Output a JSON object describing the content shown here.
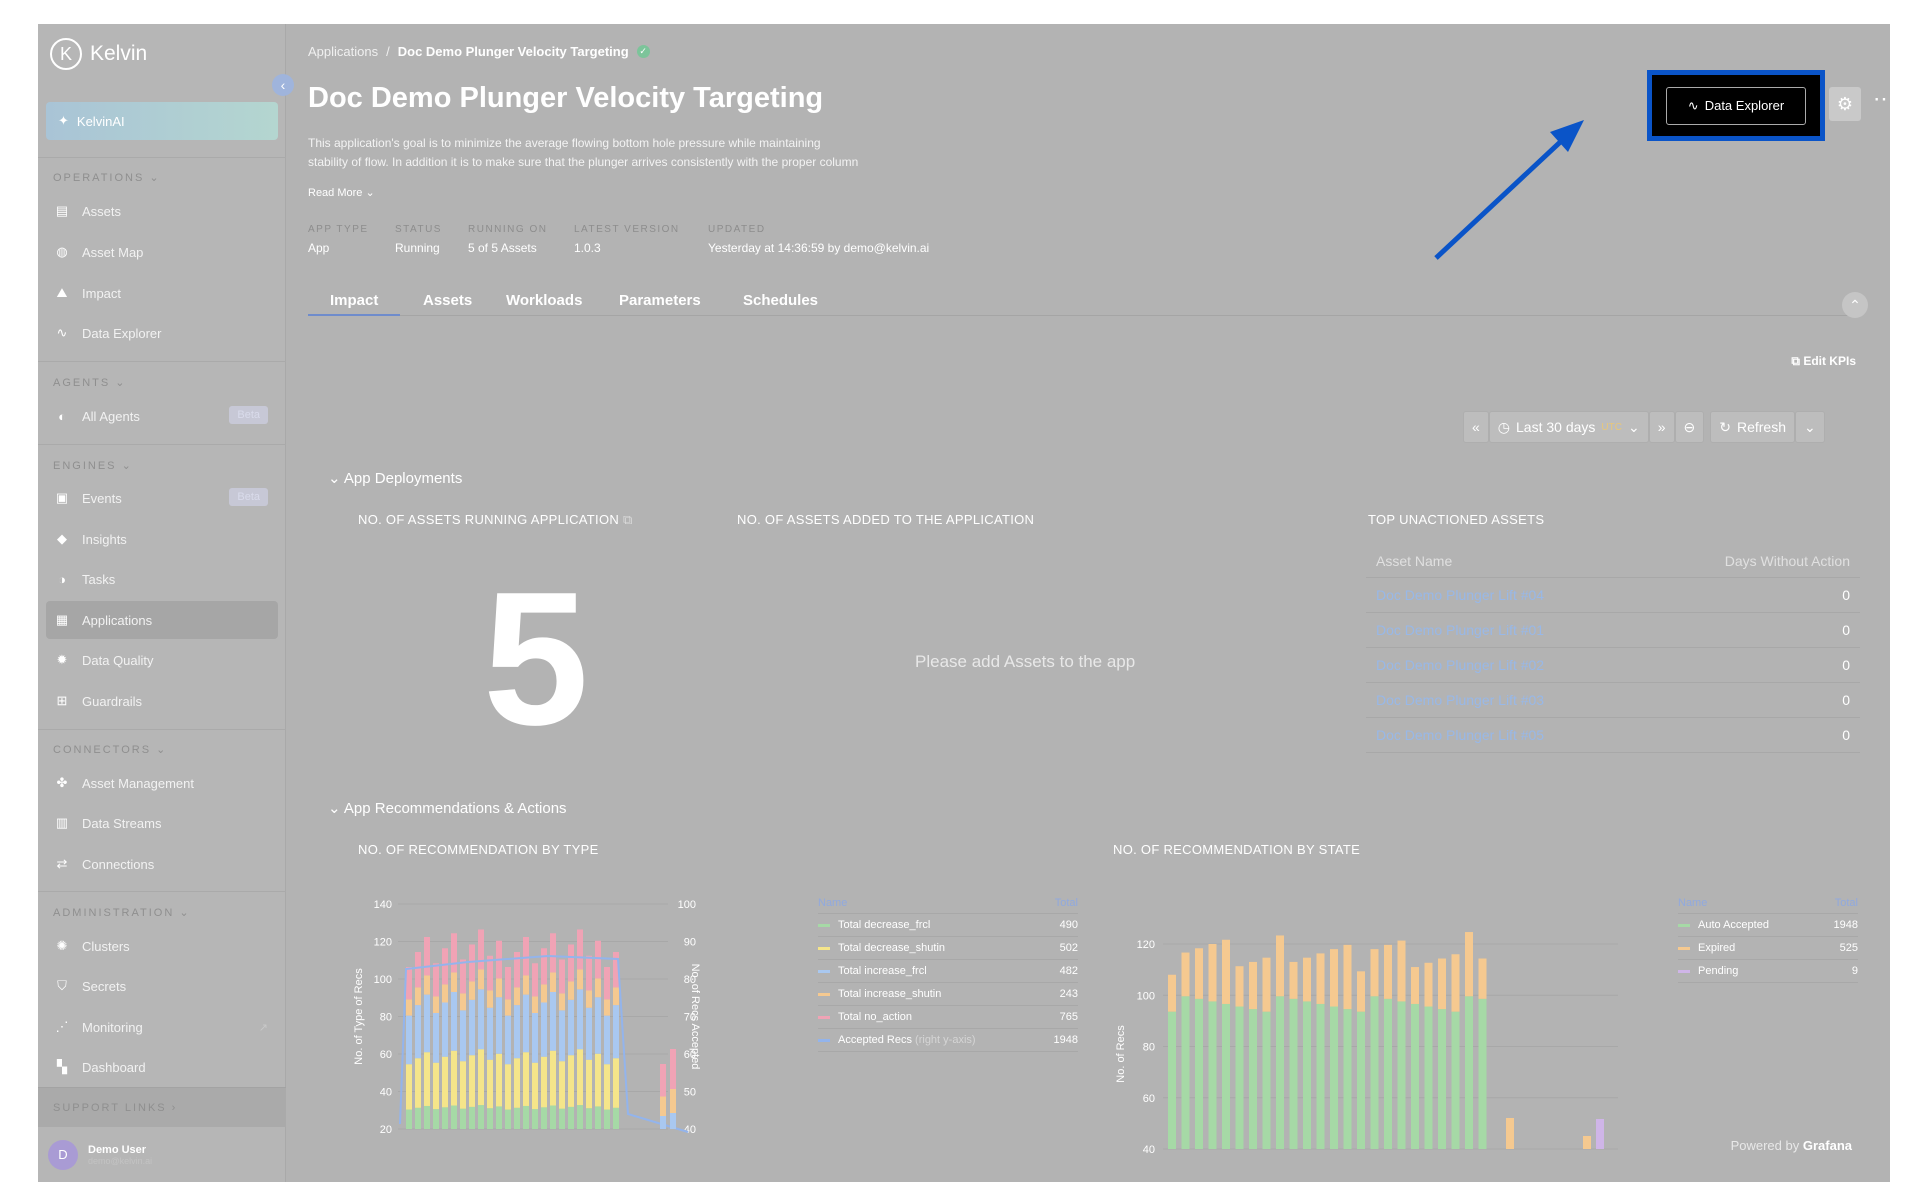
{
  "brand": {
    "name": "Kelvin"
  },
  "kelvinai": {
    "label": "KelvinAI"
  },
  "sidebar": {
    "operations_label": "OPERATIONS",
    "agents_label": "AGENTS",
    "engines_label": "ENGINES",
    "connectors_label": "CONNECTORS",
    "administration_label": "ADMINISTRATION",
    "support_label": "SUPPORT LINKS",
    "items": [
      {
        "label": "Assets",
        "icon": "assets-icon"
      },
      {
        "label": "Asset Map",
        "icon": "globe-icon"
      },
      {
        "label": "Impact",
        "icon": "impact-icon"
      },
      {
        "label": "Data Explorer",
        "icon": "pulse-icon"
      },
      {
        "label": "All Agents",
        "icon": "agent-icon",
        "badge": "Beta"
      },
      {
        "label": "Events",
        "icon": "events-icon",
        "badge": "Beta"
      },
      {
        "label": "Insights",
        "icon": "tag-icon"
      },
      {
        "label": "Tasks",
        "icon": "tasks-icon"
      },
      {
        "label": "Applications",
        "icon": "grid-icon"
      },
      {
        "label": "Data Quality",
        "icon": "gear-icon"
      },
      {
        "label": "Guardrails",
        "icon": "guardrail-icon"
      },
      {
        "label": "Asset Management",
        "icon": "asset-mgmt-icon"
      },
      {
        "label": "Data Streams",
        "icon": "streams-icon"
      },
      {
        "label": "Connections",
        "icon": "connections-icon"
      },
      {
        "label": "Clusters",
        "icon": "clusters-icon"
      },
      {
        "label": "Secrets",
        "icon": "shield-icon"
      },
      {
        "label": "Monitoring",
        "icon": "monitor-icon"
      },
      {
        "label": "Dashboard",
        "icon": "dashboard-icon"
      }
    ]
  },
  "user": {
    "name": "Demo User",
    "email": "demo@kelvin.ai",
    "initial": "D"
  },
  "breadcrumb": {
    "parent": "Applications",
    "sep": "/",
    "current": "Doc Demo Plunger Velocity Targeting"
  },
  "page": {
    "title": "Doc Demo Plunger Velocity Targeting",
    "desc_line1": "This application's goal is to minimize the average flowing bottom hole pressure while maintaining",
    "desc_line2": "stability of flow. In addition it is to make sure that the plunger arrives consistently with the proper column",
    "read_more": "Read More"
  },
  "meta": [
    {
      "label": "APP TYPE",
      "value": "App"
    },
    {
      "label": "STATUS",
      "value": "Running"
    },
    {
      "label": "RUNNING ON",
      "value": "5 of 5 Assets"
    },
    {
      "label": "LATEST VERSION",
      "value": "1.0.3"
    },
    {
      "label": "UPDATED",
      "value": "Yesterday at 14:36:59 by demo@kelvin.ai"
    }
  ],
  "tabs": [
    "Impact",
    "Assets",
    "Workloads",
    "Parameters",
    "Schedules"
  ],
  "actions": {
    "data_explorer": "Data Explorer",
    "edit_kpis": "Edit KPIs"
  },
  "timebar": {
    "range": "Last 30 days",
    "tz": "UTC",
    "refresh": "Refresh"
  },
  "sections": {
    "deployments": "App Deployments",
    "recommendations": "App Recommendations & Actions"
  },
  "panels": {
    "running": "NO. OF ASSETS RUNNING APPLICATION",
    "added": "NO. OF ASSETS ADDED TO THE APPLICATION",
    "unactioned": "TOP UNACTIONED ASSETS",
    "by_type": "NO. OF RECOMMENDATION BY TYPE",
    "by_state": "NO. OF RECOMMENDATION BY STATE"
  },
  "running_count": "5",
  "empty_msg": "Please add Assets to the app",
  "unactioned": {
    "headers": [
      "Asset Name",
      "Days Without Action"
    ],
    "rows": [
      {
        "name": "Doc Demo Plunger Lift #04",
        "days": "0"
      },
      {
        "name": "Doc Demo Plunger Lift #01",
        "days": "0"
      },
      {
        "name": "Doc Demo Plunger Lift #02",
        "days": "0"
      },
      {
        "name": "Doc Demo Plunger Lift #03",
        "days": "0"
      },
      {
        "name": "Doc Demo Plunger Lift #05",
        "days": "0"
      }
    ]
  },
  "legend_type": {
    "headers": [
      "Name",
      "Total"
    ],
    "rows": [
      {
        "name": "Total decrease_frcl",
        "total": "490",
        "color": "#a6d9a6"
      },
      {
        "name": "Total decrease_shutin",
        "total": "502",
        "color": "#f5e58a"
      },
      {
        "name": "Total increase_frcl",
        "total": "482",
        "color": "#a9c8f0"
      },
      {
        "name": "Total increase_shutin",
        "total": "243",
        "color": "#f5c990"
      },
      {
        "name": "Total no_action",
        "total": "765",
        "color": "#f0a3b5"
      },
      {
        "name": "Accepted Recs",
        "suffix": "(right y-axis)",
        "total": "1948",
        "color": "#93b4ec"
      }
    ]
  },
  "legend_state": {
    "headers": [
      "Name",
      "Total"
    ],
    "rows": [
      {
        "name": "Auto Accepted",
        "total": "1948",
        "color": "#a6d9a6"
      },
      {
        "name": "Expired",
        "total": "525",
        "color": "#f5c990"
      },
      {
        "name": "Pending",
        "total": "9",
        "color": "#cfb5e8"
      }
    ]
  },
  "chart_data": [
    {
      "type": "bar",
      "title": "NO. OF RECOMMENDATION BY TYPE",
      "ylabel": "No. of Type of Recs",
      "y2label": "No. of Recs Accepted",
      "ylim": [
        20,
        140
      ],
      "y2lim": [
        40,
        100
      ],
      "yticks": [
        "140",
        "120",
        "100",
        "80",
        "60",
        "40",
        "20"
      ],
      "y2ticks": [
        "100",
        "90",
        "80",
        "70",
        "60",
        "50",
        "40"
      ],
      "stacked": true
    },
    {
      "type": "bar",
      "title": "NO. OF RECOMMENDATION BY STATE",
      "ylabel": "No. of Recs",
      "ylim": [
        40,
        130
      ],
      "yticks": [
        "120",
        "100",
        "80",
        "60",
        "40"
      ],
      "stacked": true
    }
  ],
  "footer": {
    "powered": "Powered by",
    "grafana": "Grafana"
  }
}
